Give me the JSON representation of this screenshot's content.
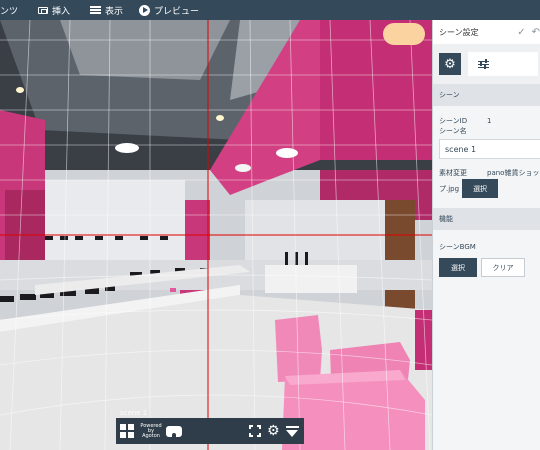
{
  "menu": {
    "contents_label": "ンツ",
    "insert_label": "挿入",
    "view_label": "表示",
    "preview_label": "プレビュー"
  },
  "viewer": {
    "scene_label": "scene 1",
    "powered_by": [
      "Powered",
      "by",
      "Agoton"
    ]
  },
  "panel": {
    "title": "シーン設定",
    "section_scene": "シーン",
    "scene_id_label": "シーンID",
    "scene_id_value": "1",
    "scene_name_label": "シーン名",
    "scene_name_value": "scene 1",
    "material_change_label": "素材変更",
    "material_file_head": "pano雑貨ショッ",
    "material_file_tail": "プ.jpg",
    "select_label": "選択",
    "section_function": "機能",
    "scene_bgm_label": "シーンBGM",
    "bgm_select_label": "選択",
    "bgm_clear_label": "クリア"
  },
  "colors": {
    "toolbar": "#34495a",
    "accent_pink": "#d6296f",
    "guide_red": "#e00000"
  },
  "icons": [
    "insert-icon",
    "view-icon",
    "preview-play-icon",
    "check-icon",
    "undo-icon",
    "gear-icon",
    "sliders-icon",
    "grid-icon",
    "vr-goggles-icon",
    "fullscreen-icon",
    "settings-icon",
    "menu-down-icon"
  ]
}
